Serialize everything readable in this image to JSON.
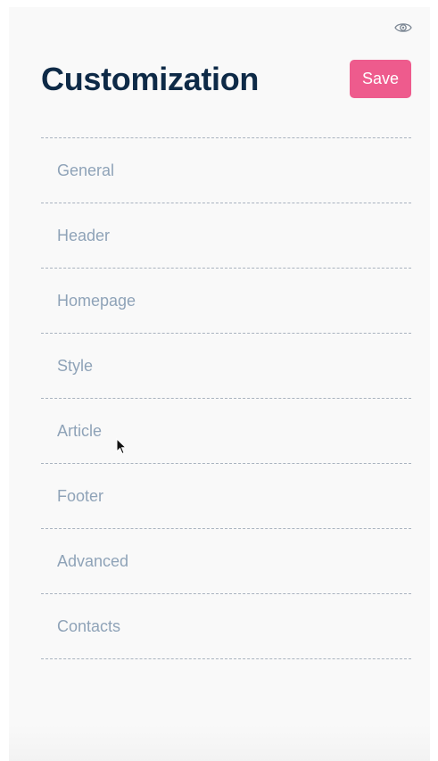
{
  "page": {
    "title": "Customization",
    "save_label": "Save",
    "accent_color": "#ee5b8d"
  },
  "icons": {
    "preview": "eye-icon",
    "cursor": "mouse-pointer-icon"
  },
  "menu": {
    "items": [
      {
        "label": "General"
      },
      {
        "label": "Header"
      },
      {
        "label": "Homepage"
      },
      {
        "label": "Style"
      },
      {
        "label": "Article"
      },
      {
        "label": "Footer"
      },
      {
        "label": "Advanced"
      },
      {
        "label": "Contacts"
      }
    ]
  }
}
